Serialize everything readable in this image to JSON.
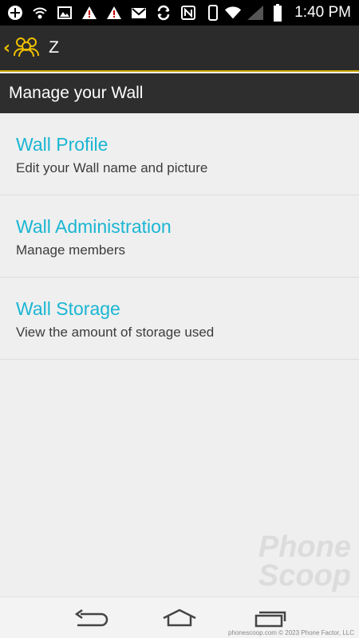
{
  "status_bar": {
    "time": "1:40 PM",
    "icons": [
      "add-icon",
      "wifi-call-icon",
      "image-icon",
      "warning-icon",
      "warning-icon",
      "gmail-icon",
      "sync-icon",
      "nfc-icon",
      "phone-outline-icon",
      "wifi-icon",
      "signal-icon",
      "battery-icon"
    ]
  },
  "action_bar": {
    "title": "Z",
    "icon": "group-people-icon"
  },
  "subheader": {
    "title": "Manage your Wall"
  },
  "items": [
    {
      "title": "Wall Profile",
      "subtitle": "Edit your Wall name and picture"
    },
    {
      "title": "Wall Administration",
      "subtitle": "Manage members"
    },
    {
      "title": "Wall Storage",
      "subtitle": "View the amount of storage used"
    }
  ],
  "watermark": {
    "line1": "Phone",
    "line2": "Scoop"
  },
  "footer": {
    "credit": "phonescoop.com  © 2023 Phone Factor, LLC"
  },
  "colors": {
    "accent": "#1ab6d3",
    "brand_yellow": "#f0c000",
    "bar_dark": "#2b2b2b"
  }
}
